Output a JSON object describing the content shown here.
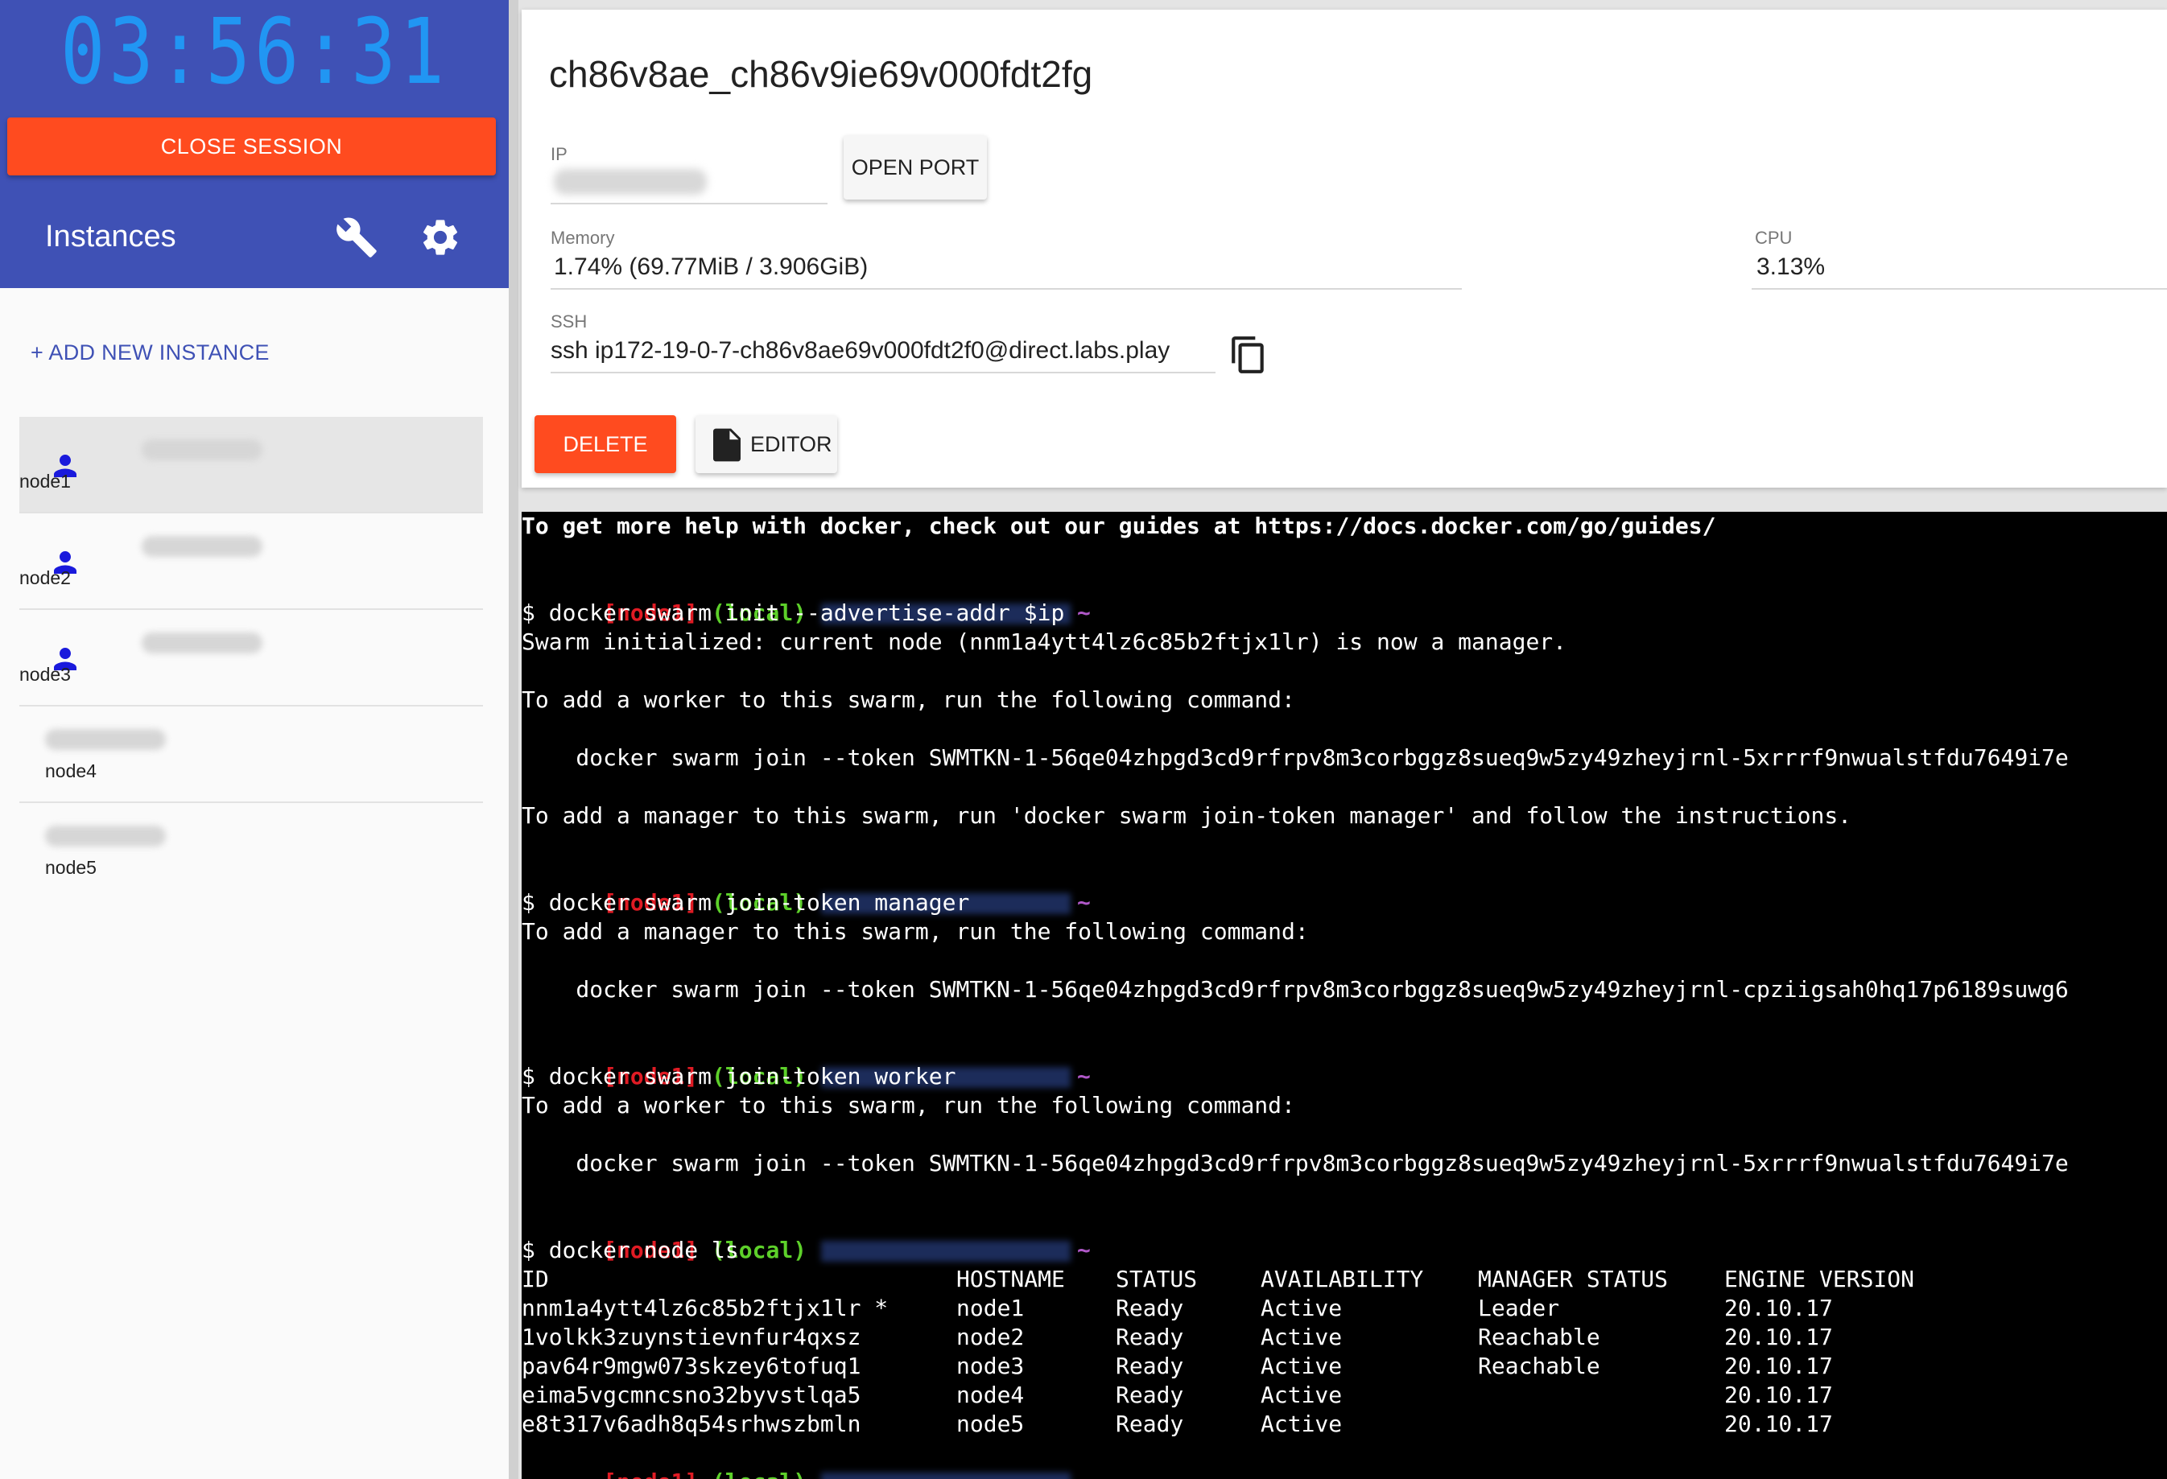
{
  "session": {
    "timer": "03:56:31",
    "close_label": "CLOSE SESSION"
  },
  "sidebar": {
    "title": "Instances",
    "add_label": "+ ADD NEW INSTANCE",
    "instances": [
      {
        "name": "node1",
        "icon": "person-icon",
        "active": true
      },
      {
        "name": "node2",
        "icon": "person-icon",
        "active": false
      },
      {
        "name": "node3",
        "icon": "person-icon",
        "active": false
      },
      {
        "name": "node4",
        "icon": null,
        "active": false
      },
      {
        "name": "node5",
        "icon": null,
        "active": false
      }
    ]
  },
  "instance": {
    "title": "ch86v8ae_ch86v9ie69v000fdt2fg",
    "ip_label": "IP",
    "open_port_label": "OPEN PORT",
    "memory_label": "Memory",
    "memory_value": "1.74% (69.77MiB / 3.906GiB)",
    "cpu_label": "CPU",
    "cpu_value": "3.13%",
    "ssh_label": "SSH",
    "ssh_value": "ssh ip172-19-0-7-ch86v8ae69v000fdt2f0@direct.labs.play",
    "delete_label": "DELETE",
    "editor_label": "EDITOR"
  },
  "terminal": {
    "prompt": {
      "node": "[node1]",
      "local": "(local)",
      "tilde": "~"
    },
    "lines": {
      "help": "To get more help with docker, check out our guides at https://docs.docker.com/go/guides/",
      "cmd1": "$ docker swarm init --advertise-addr $ip",
      "out1": "Swarm initialized: current node (nnm1a4ytt4lz6c85b2ftjx1lr) is now a manager.",
      "out2": "To add a worker to this swarm, run the following command:",
      "out3": "    docker swarm join --token SWMTKN-1-56qe04zhpgd3cd9rfrpv8m3corbggz8sueq9w5zy49zheyjrnl-5xrrrf9nwualstfdu7649i7e",
      "out4": "To add a manager to this swarm, run 'docker swarm join-token manager' and follow the instructions.",
      "cmd2": "$ docker swarm join-token manager",
      "out5": "To add a manager to this swarm, run the following command:",
      "out6": "    docker swarm join --token SWMTKN-1-56qe04zhpgd3cd9rfrpv8m3corbggz8sueq9w5zy49zheyjrnl-cpziigsah0hq17p6189suwg6",
      "cmd3": "$ docker swarm join-token worker",
      "out7": "To add a worker to this swarm, run the following command:",
      "out8": "    docker swarm join --token SWMTKN-1-56qe04zhpgd3cd9rfrpv8m3corbggz8sueq9w5zy49zheyjrnl-5xrrrf9nwualstfdu7649i7e",
      "cmd4": "$ docker node ls",
      "last_prompt_dollar": "$"
    },
    "node_table": {
      "headers": [
        "ID",
        "HOSTNAME",
        "STATUS",
        "AVAILABILITY",
        "MANAGER STATUS",
        "ENGINE VERSION"
      ],
      "rows": [
        [
          "nnm1a4ytt4lz6c85b2ftjx1lr *",
          "node1",
          "Ready",
          "Active",
          "Leader",
          "20.10.17"
        ],
        [
          "1volkk3zuynstievnfur4qxsz",
          "node2",
          "Ready",
          "Active",
          "Reachable",
          "20.10.17"
        ],
        [
          "pav64r9mgw073skzey6tofuq1",
          "node3",
          "Ready",
          "Active",
          "Reachable",
          "20.10.17"
        ],
        [
          "eima5vgcmncsno32byvstlqa5",
          "node4",
          "Ready",
          "Active",
          "",
          "20.10.17"
        ],
        [
          "e8t317v6adh8q54srhwszbmln",
          "node5",
          "Ready",
          "Active",
          "",
          "20.10.17"
        ]
      ]
    }
  },
  "colors": {
    "sidebar_header": "#3f51b5",
    "timer": "#2196f3",
    "accent_red": "#ff4b1f",
    "prompt_red": "#e01b24",
    "prompt_green": "#5dd02a",
    "prompt_purple": "#b058c8"
  }
}
